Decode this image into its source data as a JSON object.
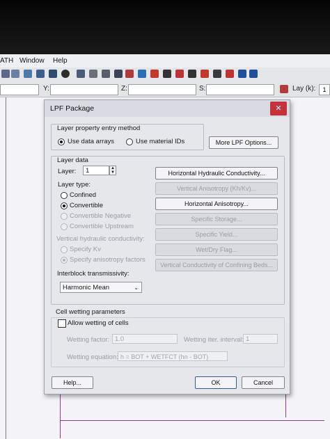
{
  "app": {
    "menu": [
      "ATH",
      "Window",
      "Help"
    ],
    "coord_labels": [
      "Y:",
      "Z:",
      "S:"
    ],
    "layer_label": "Lay (k):",
    "layer_value": "1"
  },
  "dialog": {
    "title": "LPF Package",
    "close_glyph": "✕",
    "entry_method": {
      "legend": "Layer property entry method",
      "options": [
        "Use data arrays",
        "Use material IDs"
      ],
      "selected": 0
    },
    "more_options_label": "More LPF Options...",
    "layer_data": {
      "legend": "Layer data",
      "layer_label": "Layer:",
      "layer_value": "1",
      "layer_type_label": "Layer type:",
      "layer_types": [
        "Confined",
        "Convertible",
        "Convertible Negative",
        "Convertible Upstream"
      ],
      "layer_type_selected": 1,
      "vhc_label": "Vertical hydraulic conductivity:",
      "vhc_options": [
        "Specify Kv",
        "Specify anisotropy factors"
      ],
      "vhc_selected": 1,
      "interblock_label": "Interblock transmissivity:",
      "interblock_value": "Harmonic Mean"
    },
    "property_buttons": [
      "Horizontal Hydraulic Conductivity...",
      "Vertical Anisotropy (Kh/Kv)...",
      "Horizontal Anisotropy...",
      "Specific Storage...",
      "Specific Yield...",
      "Wet/Dry Flag...",
      "Vertical Conductivity of Confining Beds..."
    ],
    "wetting": {
      "legend": "Cell wetting parameters",
      "allow_label": "Allow wetting of cells",
      "factor_label": "Wetting factor:",
      "factor_value": "1.0",
      "iter_label": "Wetting iter. interval:",
      "iter_value": "1",
      "equation_label": "Wetting equation:",
      "equation_value": "h = BOT + WETFCT (hn - BOT)"
    },
    "footer": {
      "help_label": "Help...",
      "ok_label": "OK",
      "cancel_label": "Cancel"
    }
  },
  "colors": {
    "close_button": "#c4323a",
    "canvas_line": "#8e3a8e"
  }
}
